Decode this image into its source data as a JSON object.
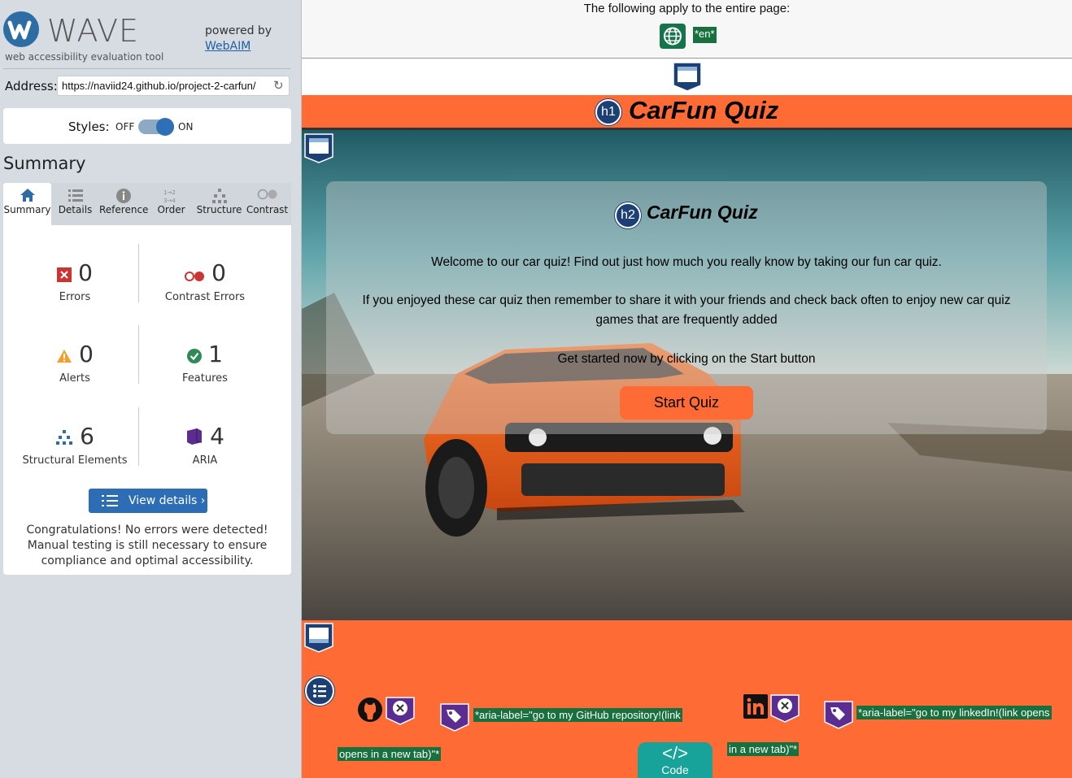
{
  "wave": {
    "logo_text": "WAVE",
    "subtitle": "web accessibility evaluation tool",
    "powered_by": "powered by",
    "webaim_link": "WebAIM",
    "address_label": "Address:",
    "address_value": "https://naviid24.github.io/project-2-carfun/",
    "styles_label": "Styles:",
    "styles_off": "OFF",
    "styles_on": "ON",
    "styles_state": "on",
    "summary_title": "Summary",
    "tabs": [
      {
        "label": "Summary",
        "icon": "home-icon",
        "active": true
      },
      {
        "label": "Details",
        "icon": "list-icon"
      },
      {
        "label": "Reference",
        "icon": "info-icon"
      },
      {
        "label": "Order",
        "icon": "order-icon"
      },
      {
        "label": "Structure",
        "icon": "hierarchy-icon"
      },
      {
        "label": "Contrast",
        "icon": "contrast-icon"
      }
    ],
    "stats": {
      "errors": {
        "value": "0",
        "label": "Errors",
        "color": "#cc3333"
      },
      "contrast_errors": {
        "value": "0",
        "label": "Contrast Errors",
        "color": "#cc3333"
      },
      "alerts": {
        "value": "0",
        "label": "Alerts",
        "color": "#f0a030"
      },
      "features": {
        "value": "1",
        "label": "Features",
        "color": "#2e8b57"
      },
      "structural": {
        "value": "6",
        "label": "Structural Elements",
        "color": "#2e6da4"
      },
      "aria": {
        "value": "4",
        "label": "ARIA",
        "color": "#5b2d91"
      }
    },
    "view_details": "View details ›",
    "congrats": "Congratulations! No errors were detected! Manual testing is still necessary to ensure compliance and optimal accessibility."
  },
  "page": {
    "apply_text": "The following apply to the entire page:",
    "lang_badge": "*en*",
    "h1_marker": "h1",
    "h1_text": "CarFun Quiz",
    "h2_marker": "h2",
    "h2_text": "CarFun Quiz",
    "welcome": "Welcome to our car quiz! Find out just how much you really know by taking our fun car quiz.",
    "share": "If you enjoyed these car quiz then remember to share it with your friends and check back often to enjoy new car quiz games that are frequently added",
    "get_started": "Get started now by clicking on the Start button",
    "start_button": "Start Quiz",
    "github_aria_1": "*aria-label=\"go to my GitHub repository!(link",
    "github_aria_2": "opens in a new tab)\"*",
    "linkedin_aria_1": "*aria-label=\"go to my linkedIn!(link opens",
    "linkedin_aria_2": "in a new tab)\"*",
    "code_tab_label": "Code",
    "accent_orange": "#ff6b35",
    "wave_green": "#17703e",
    "wave_navy": "#1c3f75",
    "aria_purple": "#5b2d91"
  }
}
